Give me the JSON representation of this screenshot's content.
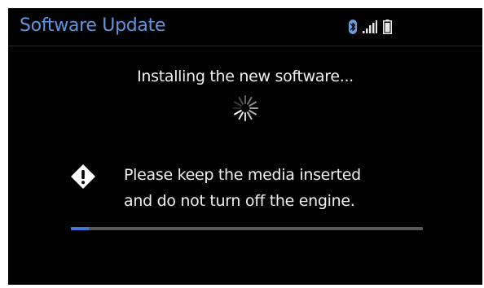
{
  "header": {
    "title": "Software Update",
    "icons": [
      "bluetooth-icon",
      "signal-strength-icon",
      "battery-icon"
    ]
  },
  "main": {
    "status_text": "Installing the new software...",
    "spinner_icon": "loading-spinner-icon",
    "warning_icon": "warning-diamond-icon",
    "warning_lines": [
      "Please keep the media inserted",
      "and do not turn off the engine."
    ],
    "progress_fraction": 0.05
  },
  "colors": {
    "title": "#5d95e2",
    "background": "#000000",
    "text": "#f0f0f0",
    "progress_fill": "#3f78d8",
    "progress_track": "#5a5a5a"
  }
}
